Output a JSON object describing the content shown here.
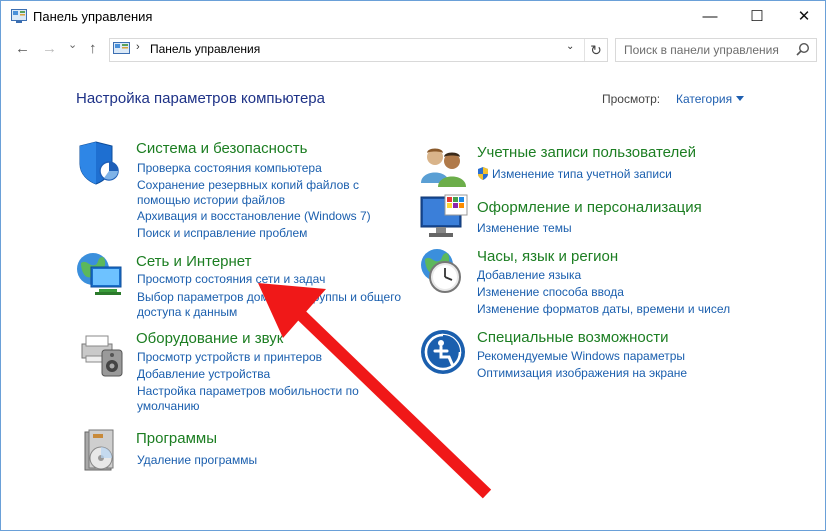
{
  "window": {
    "title": "Панель управления",
    "controls": {
      "minimize": "—",
      "maximize": "☐",
      "close": "✕"
    }
  },
  "nav": {
    "back": "←",
    "forward": "→",
    "dropdown": "⌄",
    "up": "↑"
  },
  "address": {
    "separator": "›",
    "path": "Панель управления",
    "drop": "⌄",
    "refresh": "↻"
  },
  "search": {
    "placeholder": "Поиск в панели управления"
  },
  "main": {
    "heading": "Настройка параметров компьютера",
    "view_by_label": "Просмотр:",
    "view_by_value": "Категория"
  },
  "groups": {
    "system": {
      "title": "Система и безопасность",
      "links": [
        "Проверка состояния компьютера",
        "Сохранение резервных копий файлов с",
        "помощью истории файлов",
        "Архивация и восстановление (Windows 7)",
        "Поиск и исправление проблем"
      ]
    },
    "network": {
      "title": "Сеть и Интернет",
      "links": [
        "Просмотр состояния сети и задач",
        "Выбор параметров домашней группы и общего",
        "доступа к данным"
      ]
    },
    "hardware": {
      "title": "Оборудование и звук",
      "links": [
        "Просмотр устройств и принтеров",
        "Добавление устройства",
        "Настройка параметров мобильности по",
        "умолчанию"
      ]
    },
    "programs": {
      "title": "Программы",
      "links": [
        "Удаление программы"
      ]
    },
    "accounts": {
      "title": "Учетные записи пользователей",
      "links": [
        "Изменение типа учетной записи"
      ]
    },
    "appearance": {
      "title": "Оформление и персонализация",
      "links": [
        "Изменение темы"
      ]
    },
    "clock": {
      "title": "Часы, язык и регион",
      "links": [
        "Добавление языка",
        "Изменение способа ввода",
        "Изменение форматов даты, времени и чисел"
      ]
    },
    "access": {
      "title": "Специальные возможности",
      "links": [
        "Рекомендуемые Windows параметры",
        "Оптимизация изображения на экране"
      ]
    }
  },
  "colors": {
    "heading": "#1e3287",
    "group_title": "#1c7e22",
    "link": "#1b5fae",
    "annotation_arrow": "#f01818"
  }
}
